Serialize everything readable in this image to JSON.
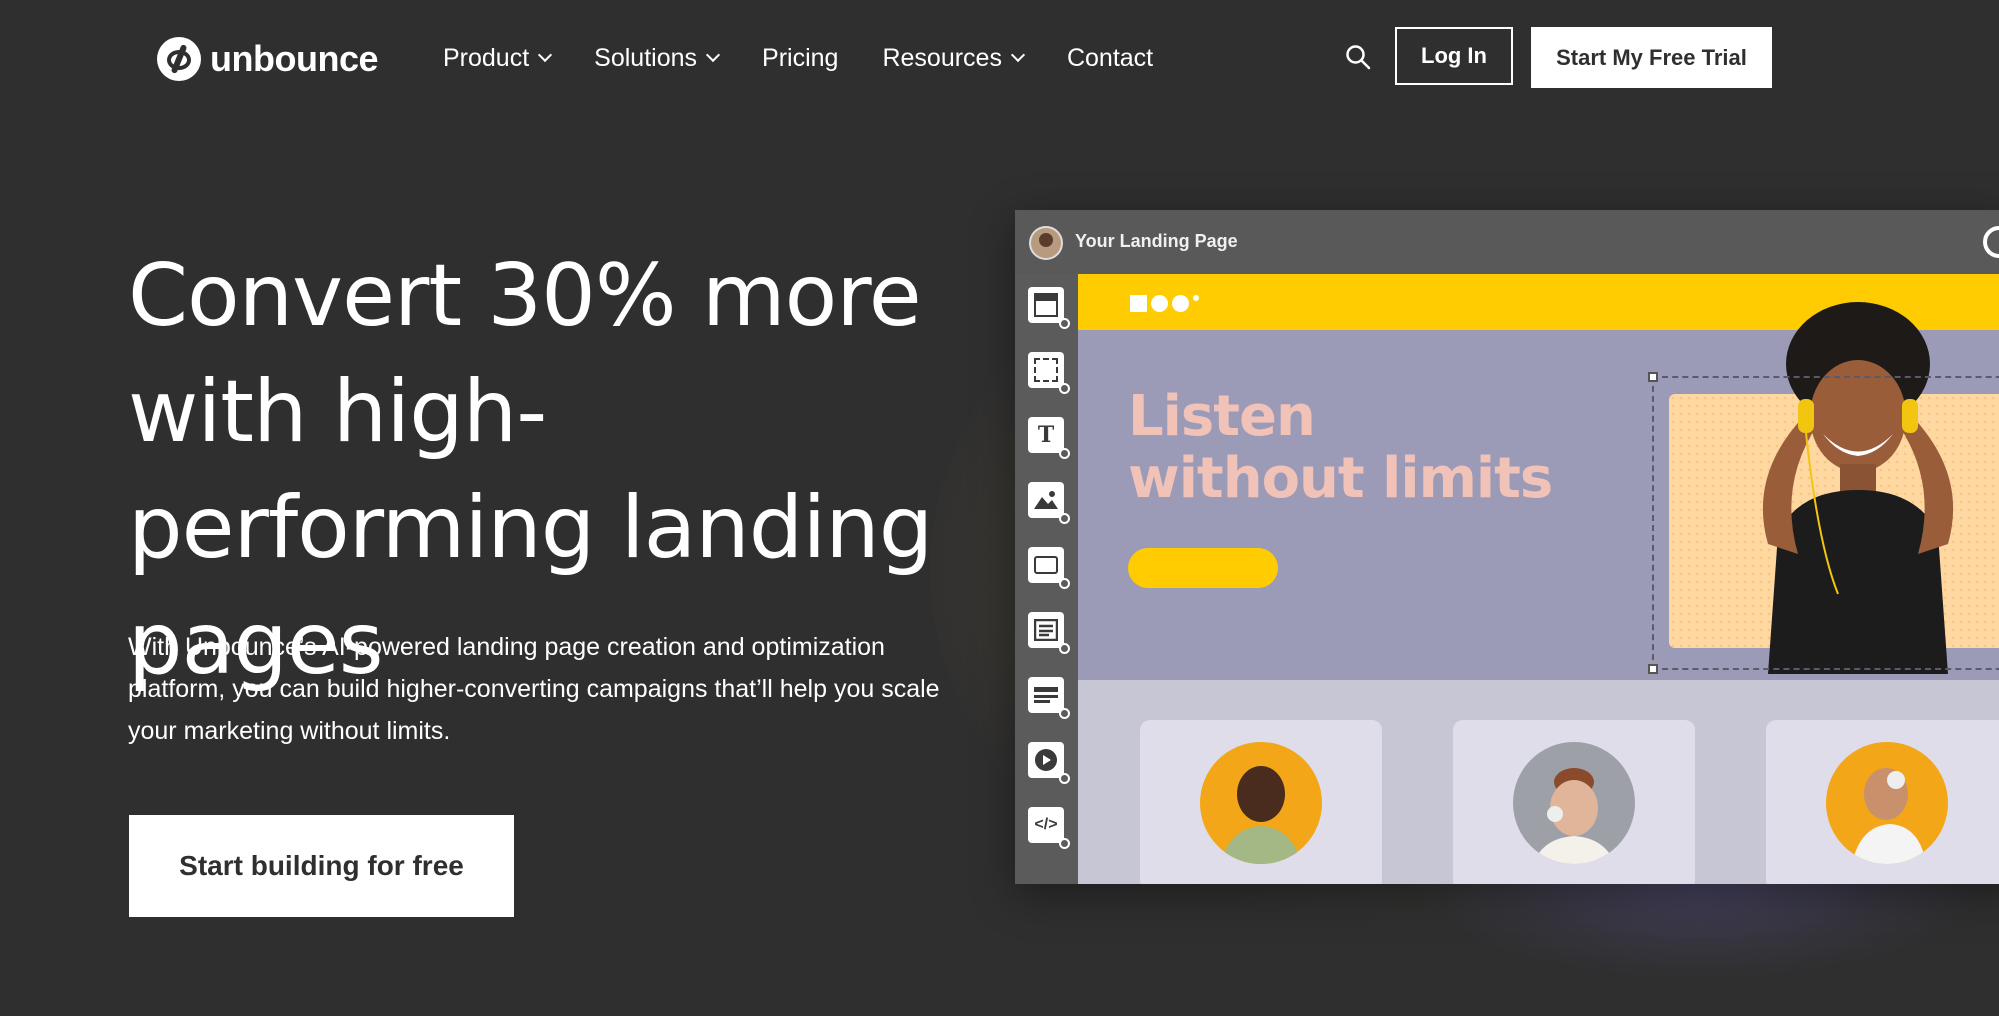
{
  "nav": {
    "brand": "unbounce",
    "items": [
      {
        "label": "Product",
        "has_dropdown": true
      },
      {
        "label": "Solutions",
        "has_dropdown": true
      },
      {
        "label": "Pricing",
        "has_dropdown": false
      },
      {
        "label": "Resources",
        "has_dropdown": true
      },
      {
        "label": "Contact",
        "has_dropdown": false
      }
    ],
    "search_icon": "search-icon",
    "login_label": "Log In",
    "trial_label": "Start My Free Trial"
  },
  "hero": {
    "title": "Convert 30% more with high-performing landing pages",
    "subtitle": "With Unbounce’s AI-powered landing page creation and optimization platform, you can build higher-converting campaigns that’ll help you scale your marketing without limits.",
    "cta_label": "Start building for free"
  },
  "mockup": {
    "window_title": "Your Landing Page",
    "headline": "Listen without limits",
    "tools": [
      "section-icon",
      "box-icon",
      "text-icon",
      "image-icon",
      "button-icon",
      "form-icon",
      "list-icon",
      "video-icon",
      "code-icon"
    ],
    "colors": {
      "accent": "#fecc00",
      "panel": "#9c9bb7",
      "headline": "#f0c2b8"
    }
  }
}
